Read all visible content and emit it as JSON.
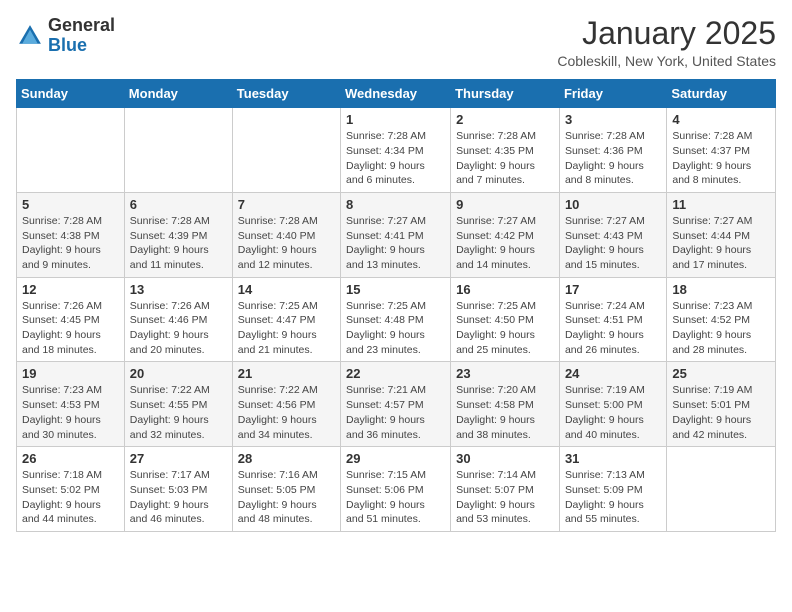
{
  "header": {
    "logo_general": "General",
    "logo_blue": "Blue",
    "month_title": "January 2025",
    "location": "Cobleskill, New York, United States"
  },
  "weekdays": [
    "Sunday",
    "Monday",
    "Tuesday",
    "Wednesday",
    "Thursday",
    "Friday",
    "Saturday"
  ],
  "weeks": [
    [
      {
        "day": "",
        "info": ""
      },
      {
        "day": "",
        "info": ""
      },
      {
        "day": "",
        "info": ""
      },
      {
        "day": "1",
        "info": "Sunrise: 7:28 AM\nSunset: 4:34 PM\nDaylight: 9 hours and 6 minutes."
      },
      {
        "day": "2",
        "info": "Sunrise: 7:28 AM\nSunset: 4:35 PM\nDaylight: 9 hours and 7 minutes."
      },
      {
        "day": "3",
        "info": "Sunrise: 7:28 AM\nSunset: 4:36 PM\nDaylight: 9 hours and 8 minutes."
      },
      {
        "day": "4",
        "info": "Sunrise: 7:28 AM\nSunset: 4:37 PM\nDaylight: 9 hours and 8 minutes."
      }
    ],
    [
      {
        "day": "5",
        "info": "Sunrise: 7:28 AM\nSunset: 4:38 PM\nDaylight: 9 hours and 9 minutes."
      },
      {
        "day": "6",
        "info": "Sunrise: 7:28 AM\nSunset: 4:39 PM\nDaylight: 9 hours and 11 minutes."
      },
      {
        "day": "7",
        "info": "Sunrise: 7:28 AM\nSunset: 4:40 PM\nDaylight: 9 hours and 12 minutes."
      },
      {
        "day": "8",
        "info": "Sunrise: 7:27 AM\nSunset: 4:41 PM\nDaylight: 9 hours and 13 minutes."
      },
      {
        "day": "9",
        "info": "Sunrise: 7:27 AM\nSunset: 4:42 PM\nDaylight: 9 hours and 14 minutes."
      },
      {
        "day": "10",
        "info": "Sunrise: 7:27 AM\nSunset: 4:43 PM\nDaylight: 9 hours and 15 minutes."
      },
      {
        "day": "11",
        "info": "Sunrise: 7:27 AM\nSunset: 4:44 PM\nDaylight: 9 hours and 17 minutes."
      }
    ],
    [
      {
        "day": "12",
        "info": "Sunrise: 7:26 AM\nSunset: 4:45 PM\nDaylight: 9 hours and 18 minutes."
      },
      {
        "day": "13",
        "info": "Sunrise: 7:26 AM\nSunset: 4:46 PM\nDaylight: 9 hours and 20 minutes."
      },
      {
        "day": "14",
        "info": "Sunrise: 7:25 AM\nSunset: 4:47 PM\nDaylight: 9 hours and 21 minutes."
      },
      {
        "day": "15",
        "info": "Sunrise: 7:25 AM\nSunset: 4:48 PM\nDaylight: 9 hours and 23 minutes."
      },
      {
        "day": "16",
        "info": "Sunrise: 7:25 AM\nSunset: 4:50 PM\nDaylight: 9 hours and 25 minutes."
      },
      {
        "day": "17",
        "info": "Sunrise: 7:24 AM\nSunset: 4:51 PM\nDaylight: 9 hours and 26 minutes."
      },
      {
        "day": "18",
        "info": "Sunrise: 7:23 AM\nSunset: 4:52 PM\nDaylight: 9 hours and 28 minutes."
      }
    ],
    [
      {
        "day": "19",
        "info": "Sunrise: 7:23 AM\nSunset: 4:53 PM\nDaylight: 9 hours and 30 minutes."
      },
      {
        "day": "20",
        "info": "Sunrise: 7:22 AM\nSunset: 4:55 PM\nDaylight: 9 hours and 32 minutes."
      },
      {
        "day": "21",
        "info": "Sunrise: 7:22 AM\nSunset: 4:56 PM\nDaylight: 9 hours and 34 minutes."
      },
      {
        "day": "22",
        "info": "Sunrise: 7:21 AM\nSunset: 4:57 PM\nDaylight: 9 hours and 36 minutes."
      },
      {
        "day": "23",
        "info": "Sunrise: 7:20 AM\nSunset: 4:58 PM\nDaylight: 9 hours and 38 minutes."
      },
      {
        "day": "24",
        "info": "Sunrise: 7:19 AM\nSunset: 5:00 PM\nDaylight: 9 hours and 40 minutes."
      },
      {
        "day": "25",
        "info": "Sunrise: 7:19 AM\nSunset: 5:01 PM\nDaylight: 9 hours and 42 minutes."
      }
    ],
    [
      {
        "day": "26",
        "info": "Sunrise: 7:18 AM\nSunset: 5:02 PM\nDaylight: 9 hours and 44 minutes."
      },
      {
        "day": "27",
        "info": "Sunrise: 7:17 AM\nSunset: 5:03 PM\nDaylight: 9 hours and 46 minutes."
      },
      {
        "day": "28",
        "info": "Sunrise: 7:16 AM\nSunset: 5:05 PM\nDaylight: 9 hours and 48 minutes."
      },
      {
        "day": "29",
        "info": "Sunrise: 7:15 AM\nSunset: 5:06 PM\nDaylight: 9 hours and 51 minutes."
      },
      {
        "day": "30",
        "info": "Sunrise: 7:14 AM\nSunset: 5:07 PM\nDaylight: 9 hours and 53 minutes."
      },
      {
        "day": "31",
        "info": "Sunrise: 7:13 AM\nSunset: 5:09 PM\nDaylight: 9 hours and 55 minutes."
      },
      {
        "day": "",
        "info": ""
      }
    ]
  ]
}
